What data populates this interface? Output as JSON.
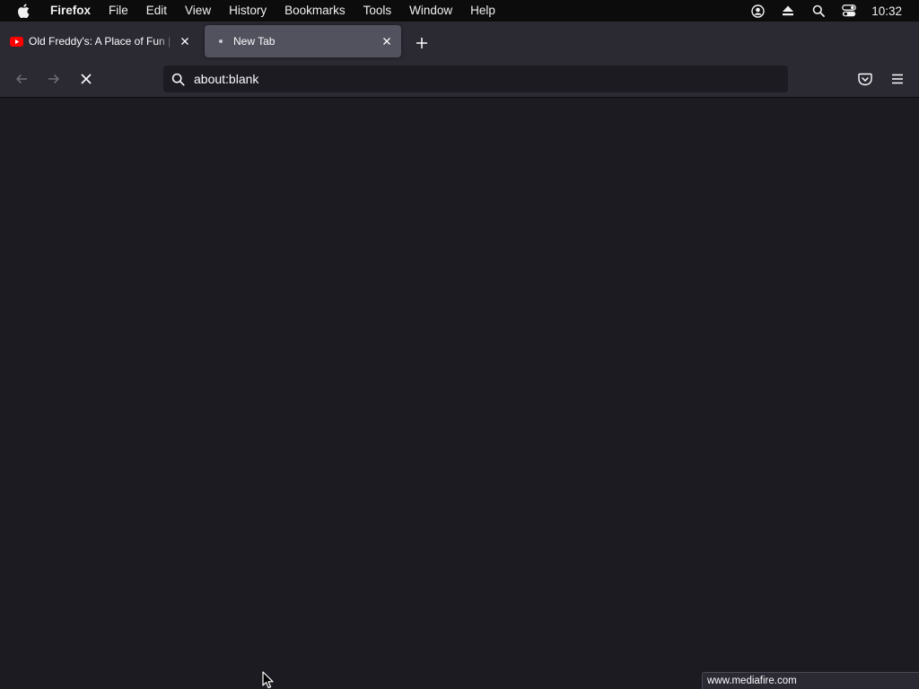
{
  "menubar": {
    "apple_icon": "apple-logo-icon",
    "items": [
      "Firefox",
      "File",
      "Edit",
      "View",
      "History",
      "Bookmarks",
      "Tools",
      "Window",
      "Help"
    ],
    "status_icons": [
      "account-icon",
      "eject-icon",
      "spotlight-search-icon",
      "control-center-icon"
    ],
    "clock": "10:32"
  },
  "tabs": [
    {
      "title": "Old Freddy's: A Place of Fun | Pl",
      "favicon": "youtube-icon",
      "active": false
    },
    {
      "title": "New Tab",
      "favicon": "loading-dot-icon",
      "active": true
    }
  ],
  "toolbar": {
    "back_icon": "back-arrow-icon",
    "forward_icon": "forward-arrow-icon",
    "stop_icon": "stop-loading-icon",
    "url": "about:blank",
    "pocket_icon": "pocket-icon",
    "menu_icon": "hamburger-menu-icon"
  },
  "status_panel": {
    "text": "www.mediafire.com"
  },
  "colors": {
    "chrome": "#2b2a33",
    "content": "#1c1b22",
    "active_tab": "#52525e",
    "menubar": "#0c0c0d",
    "youtube_red": "#ff0000"
  }
}
